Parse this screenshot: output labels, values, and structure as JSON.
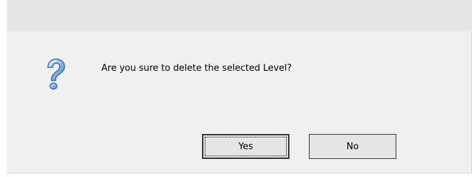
{
  "dialog": {
    "message": "Are you sure to delete the selected Level?",
    "icon": "question-icon",
    "buttons": {
      "yes_label": "Yes",
      "no_label": "No"
    },
    "default_button": "Yes"
  },
  "colors": {
    "titlebar": "#e6e6e6",
    "body": "#f0f0f0",
    "icon_blue": "#5b8fc8"
  }
}
